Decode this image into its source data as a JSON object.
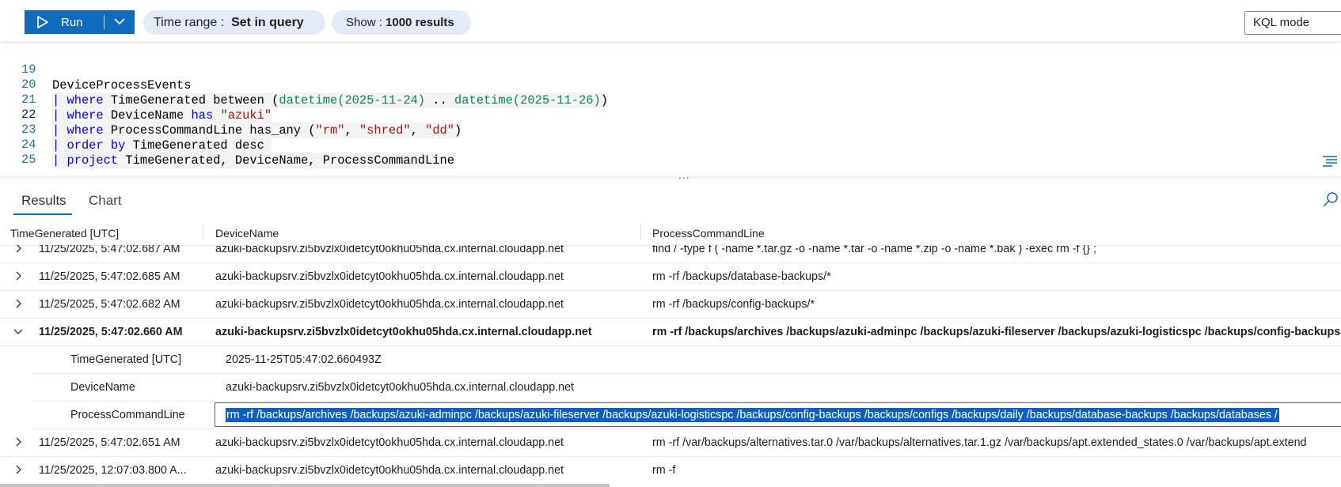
{
  "toolbar": {
    "run_label": "Run",
    "time_range_prefix": "Time range :",
    "time_range_value": "Set in query",
    "show_prefix": "Show :",
    "show_value": "1000 results",
    "mode_label": "KQL mode"
  },
  "editor": {
    "lines": [
      {
        "num": "19",
        "text": "DeviceProcessEvents"
      },
      {
        "num": "20",
        "text": "| where TimeGenerated between (datetime(2025-11-24) .. datetime(2025-11-26))"
      },
      {
        "num": "21",
        "text": "| where DeviceName has \"azuki\""
      },
      {
        "num": "22",
        "text": "| where ProcessCommandLine has_any (\"rm\", \"shred\", \"dd\")"
      },
      {
        "num": "23",
        "text": "| order by TimeGenerated desc"
      },
      {
        "num": "24",
        "text": "| project TimeGenerated, DeviceName, ProcessCommandLine"
      },
      {
        "num": "25",
        "text": ""
      }
    ],
    "splitter_dots": "..."
  },
  "results_tabs": {
    "results": "Results",
    "chart": "Chart"
  },
  "table": {
    "columns": [
      "TimeGenerated [UTC]",
      "DeviceName",
      "ProcessCommandLine"
    ],
    "rows": [
      {
        "time": "11/25/2025, 5:47:02.687 AM",
        "device": "azuki-backupsrv.zi5bvzlx0idetcyt0okhu05hda.cx.internal.cloudapp.net",
        "cmd": "find / -type f ( -name *.tar.gz -o -name *.tar -o -name *.zip -o -name *.bak ) -exec rm -f {} ;"
      },
      {
        "time": "11/25/2025, 5:47:02.685 AM",
        "device": "azuki-backupsrv.zi5bvzlx0idetcyt0okhu05hda.cx.internal.cloudapp.net",
        "cmd": "rm -rf /backups/database-backups/*"
      },
      {
        "time": "11/25/2025, 5:47:02.682 AM",
        "device": "azuki-backupsrv.zi5bvzlx0idetcyt0okhu05hda.cx.internal.cloudapp.net",
        "cmd": "rm -rf /backups/config-backups/*"
      },
      {
        "time": "11/25/2025, 5:47:02.660 AM",
        "device": "azuki-backupsrv.zi5bvzlx0idetcyt0okhu05hda.cx.internal.cloudapp.net",
        "cmd": "rm -rf /backups/archives /backups/azuki-adminpc /backups/azuki-fileserver /backups/azuki-logisticspc /backups/config-backups"
      },
      {
        "time": "11/25/2025, 5:47:02.651 AM",
        "device": "azuki-backupsrv.zi5bvzlx0idetcyt0okhu05hda.cx.internal.cloudapp.net",
        "cmd": "rm -rf /var/backups/alternatives.tar.0 /var/backups/alternatives.tar.1.gz /var/backups/apt.extended_states.0 /var/backups/apt.extend"
      },
      {
        "time": "11/25/2025, 12:07:03.800 A...",
        "device": "azuki-backupsrv.zi5bvzlx0idetcyt0okhu05hda.cx.internal.cloudapp.net",
        "cmd": "rm -f"
      }
    ],
    "expanded_detail": {
      "time_key": "TimeGenerated [UTC]",
      "time_value": "2025-11-25T05:47:02.660493Z",
      "device_key": "DeviceName",
      "device_value": "azuki-backupsrv.zi5bvzlx0idetcyt0okhu05hda.cx.internal.cloudapp.net",
      "cmd_key": "ProcessCommandLine",
      "cmd_value": "rm -rf /backups/archives /backups/azuki-adminpc /backups/azuki-fileserver /backups/azuki-logisticspc /backups/config-backups /backups/configs /backups/daily /backups/database-backups /backups/databases /"
    }
  },
  "colors": {
    "accent": "#0f6cbd",
    "pill_bg": "#e3ecf6",
    "keyword": "#0000ff",
    "string": "#a31515",
    "function": "#098658",
    "line_number": "#237893"
  }
}
